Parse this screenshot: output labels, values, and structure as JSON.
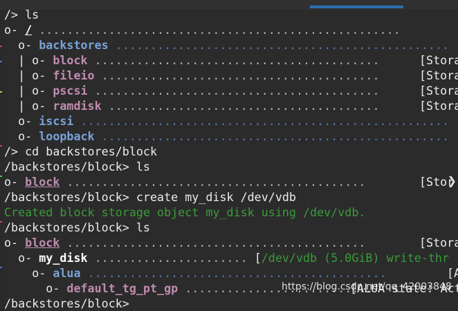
{
  "prompt_root": "/> ",
  "prompt_block": "/backstores/block> ",
  "commands": {
    "ls": "ls",
    "cd": "cd backstores/block",
    "create": "create my_disk /dev/vdb"
  },
  "tree_root": {
    "prefix": "o- ",
    "name": "/",
    "dots": " ...................................................."
  },
  "backstores": {
    "prefix": "o- ",
    "name": "backstores",
    "dots": " ................................................"
  },
  "backstore_items": [
    {
      "prefix": "| o- ",
      "name": "block",
      "dots": " .........................................",
      "info": "[Stora"
    },
    {
      "prefix": "| o- ",
      "name": "fileio",
      "dots": " ........................................",
      "info": "[Stora"
    },
    {
      "prefix": "| o- ",
      "name": "pscsi",
      "dots": " .........................................",
      "info": "[Stora"
    },
    {
      "prefix": "| o- ",
      "name": "ramdisk",
      "dots": " .......................................",
      "info": "[Stora"
    }
  ],
  "iscsi": {
    "prefix": "o- ",
    "name": "iscsi",
    "dots": " ....................................................."
  },
  "loopback": {
    "prefix": "o- ",
    "name": "loopback",
    "dots": " .................................................."
  },
  "ls_block_1": {
    "prefix": "o- ",
    "name": "block",
    "dots": " ...........................................",
    "info": "[Stor"
  },
  "create_output": "Created block storage object my_disk using /dev/vdb.",
  "ls_block_2": {
    "prefix": "o- ",
    "name": "block",
    "dots": " ...........................................",
    "info": "[Stora"
  },
  "my_disk": {
    "prefix": "o- ",
    "name": "my_disk",
    "dots": " ...................... ",
    "bracket": "[",
    "info": "/dev/vdb (5.0GiB) write-thr"
  },
  "alua": {
    "prefix": "o- ",
    "name": "alua",
    "dots": " ...........................................",
    "info": "[A"
  },
  "default_tg": {
    "prefix": "o- ",
    "name": "default_tg_pt_gp",
    "dots": " ...........................",
    "info": "[ALUA state: Acti"
  },
  "partial_last": "/backstores/block> ",
  "watermark": "https://blog.csdn.net/qq_42003848",
  "colors": {
    "background": "#2b2b2b",
    "dir_blue": "#7aa2d6",
    "item_purple": "#c08cb0",
    "success_green": "#3b9b3b",
    "tab_accent": "#2f6fb1"
  },
  "icons": {
    "side_arrow": "chevron-right-icon"
  }
}
